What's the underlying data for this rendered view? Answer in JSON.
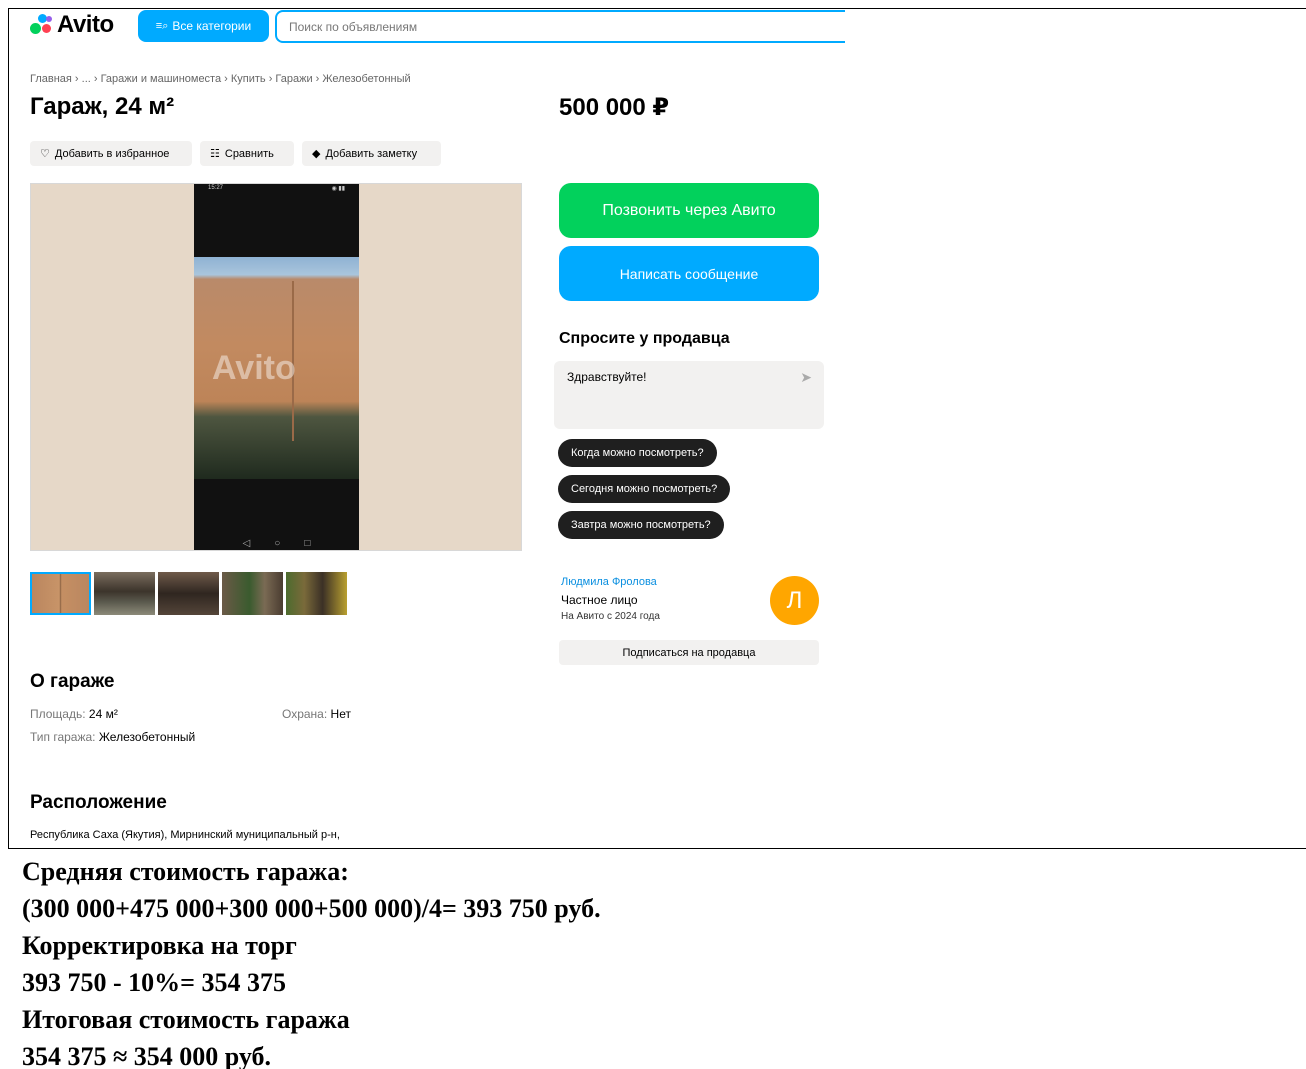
{
  "header": {
    "logo_text": "Avito",
    "categories_button": "Все категории",
    "search_placeholder": "Поиск по объявлениям"
  },
  "breadcrumb": "Главная › ... › Гаражи и машиноместа › Купить › Гаражи › Железобетонный",
  "listing": {
    "title": "Гараж, 24 м²",
    "price": "500 000 ₽",
    "actions": {
      "favorite": "Добавить в избранное",
      "compare": "Сравнить",
      "note": "Добавить заметку"
    },
    "photo_status_time": "15:27",
    "photo_watermark": "Avito"
  },
  "contact": {
    "call_button": "Позвонить через Авито",
    "message_button": "Написать сообщение",
    "ask_title": "Спросите у продавца",
    "ask_text": "Здравствуйте!",
    "chips": [
      "Когда можно посмотреть?",
      "Сегодня можно посмотреть?",
      "Завтра можно посмотреть?"
    ]
  },
  "seller": {
    "name": "Людмила Фролова",
    "type": "Частное лицо",
    "since": "На Авито с 2024 года",
    "avatar_letter": "Л",
    "subscribe_button": "Подписаться на продавца"
  },
  "about": {
    "title": "О гараже",
    "area_label": "Площадь:",
    "area_value": "24 м²",
    "security_label": "Охрана:",
    "security_value": "Нет",
    "type_label": "Тип гаража:",
    "type_value": "Железобетонный"
  },
  "location": {
    "title": "Расположение",
    "address": "Республика Саха (Якутия), Мирнинский муниципальный р-н,"
  },
  "calculation": {
    "line1": "Средняя стоимость гаража:",
    "line2": "(300 000+475 000+300 000+500 000)/4= 393 750 руб.",
    "line3": "Корректировка на торг",
    "line4": "393 750 - 10%= 354 375",
    "line5": "Итоговая стоимость гаража",
    "line6": "354 375 ≈ 354 000 руб."
  },
  "colors": {
    "accent_blue": "#00aaff",
    "call_green": "#02d15c",
    "avatar_orange": "#ffa600"
  }
}
